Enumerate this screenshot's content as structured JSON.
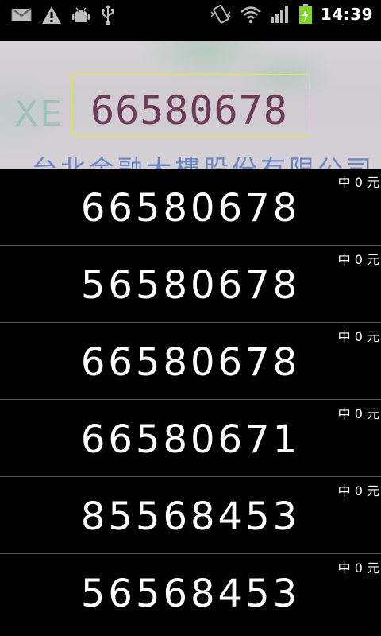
{
  "status_bar": {
    "time": "14:39",
    "icons_left": [
      "gmail-icon",
      "warning-icon",
      "android-debug-icon",
      "usb-icon"
    ],
    "icons_right": [
      "vibrate-icon",
      "wifi-icon",
      "signal-icon",
      "battery-charging-icon"
    ],
    "battery_color": "#7fd629"
  },
  "camera": {
    "detected_number": "66580678",
    "scan_box_color": "#e6e24a",
    "background_letters": "XE",
    "bottom_text": "台北金融大樓股份有限公司"
  },
  "results": [
    {
      "number": "66580678",
      "prize": "中 0 元"
    },
    {
      "number": "56580678",
      "prize": "中 0 元"
    },
    {
      "number": "66580678",
      "prize": "中 0 元"
    },
    {
      "number": "66580671",
      "prize": "中 0 元"
    },
    {
      "number": "85568453",
      "prize": "中 0 元"
    },
    {
      "number": "56568453",
      "prize": "中 0 元"
    }
  ]
}
